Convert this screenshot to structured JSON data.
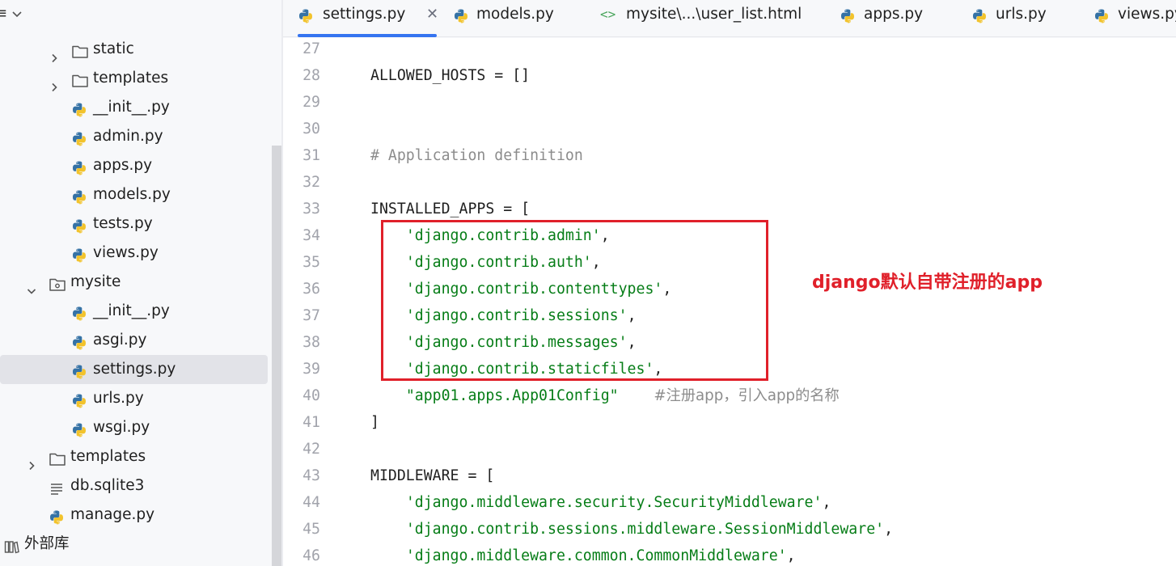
{
  "sidebar": {
    "tree": [
      {
        "label": "static",
        "type": "folder",
        "expanded": false
      },
      {
        "label": "templates",
        "type": "folder",
        "expanded": false
      },
      {
        "label": "__init__.py",
        "type": "python"
      },
      {
        "label": "admin.py",
        "type": "python"
      },
      {
        "label": "apps.py",
        "type": "python"
      },
      {
        "label": "models.py",
        "type": "python"
      },
      {
        "label": "tests.py",
        "type": "python"
      },
      {
        "label": "views.py",
        "type": "python"
      },
      {
        "label": "mysite",
        "type": "package",
        "expanded": true
      },
      {
        "label": "__init__.py",
        "type": "python"
      },
      {
        "label": "asgi.py",
        "type": "python"
      },
      {
        "label": "settings.py",
        "type": "python",
        "selected": true
      },
      {
        "label": "urls.py",
        "type": "python"
      },
      {
        "label": "wsgi.py",
        "type": "python"
      },
      {
        "label": "templates",
        "type": "folder",
        "expanded": false
      },
      {
        "label": "db.sqlite3",
        "type": "db"
      },
      {
        "label": "manage.py",
        "type": "python"
      },
      {
        "label": "外部库",
        "type": "library"
      }
    ]
  },
  "tabs": [
    {
      "label": "settings.py",
      "icon": "python-icon",
      "active": true,
      "closable": true
    },
    {
      "label": "models.py",
      "icon": "python-icon"
    },
    {
      "label": "mysite\\...\\user_list.html",
      "icon": "html-icon"
    },
    {
      "label": "apps.py",
      "icon": "python-icon"
    },
    {
      "label": "urls.py",
      "icon": "python-icon"
    },
    {
      "label": "views.py",
      "icon": "python-icon"
    }
  ],
  "editor": {
    "lines": [
      {
        "n": "27",
        "code": ""
      },
      {
        "n": "28",
        "code": "ALLOWED_HOSTS = []"
      },
      {
        "n": "29",
        "code": ""
      },
      {
        "n": "30",
        "code": ""
      },
      {
        "n": "31",
        "comment": "# Application definition"
      },
      {
        "n": "32",
        "code": ""
      },
      {
        "n": "33",
        "code": "INSTALLED_APPS = ["
      },
      {
        "n": "34",
        "indent": "    ",
        "str": "'django.contrib.admin'",
        "tail": ","
      },
      {
        "n": "35",
        "indent": "    ",
        "str": "'django.contrib.auth'",
        "tail": ","
      },
      {
        "n": "36",
        "indent": "    ",
        "str": "'django.contrib.contenttypes'",
        "tail": ","
      },
      {
        "n": "37",
        "indent": "    ",
        "str": "'django.contrib.sessions'",
        "tail": ","
      },
      {
        "n": "38",
        "indent": "    ",
        "str": "'django.contrib.messages'",
        "tail": ","
      },
      {
        "n": "39",
        "indent": "    ",
        "str": "'django.contrib.staticfiles'",
        "tail": ","
      },
      {
        "n": "40",
        "indent": "    ",
        "str": "\"app01.apps.App01Config\"",
        "tail": "    ",
        "comment": "#注册app，引入app的名称"
      },
      {
        "n": "41",
        "code": "]"
      },
      {
        "n": "42",
        "code": ""
      },
      {
        "n": "43",
        "code": "MIDDLEWARE = ["
      },
      {
        "n": "44",
        "indent": "    ",
        "str": "'django.middleware.security.SecurityMiddleware'",
        "tail": ","
      },
      {
        "n": "45",
        "indent": "    ",
        "str": "'django.contrib.sessions.middleware.SessionMiddleware'",
        "tail": ","
      },
      {
        "n": "46",
        "indent": "    ",
        "str": "'django.middleware.common.CommonMiddleware'",
        "tail": ","
      }
    ]
  },
  "annotation": {
    "text": "django默认自带注册的app",
    "color": "#e0202a"
  },
  "colors": {
    "accent": "#3574f0",
    "string": "#067d17",
    "comment": "#8c8c8c",
    "selection": "#e2e3e8"
  }
}
